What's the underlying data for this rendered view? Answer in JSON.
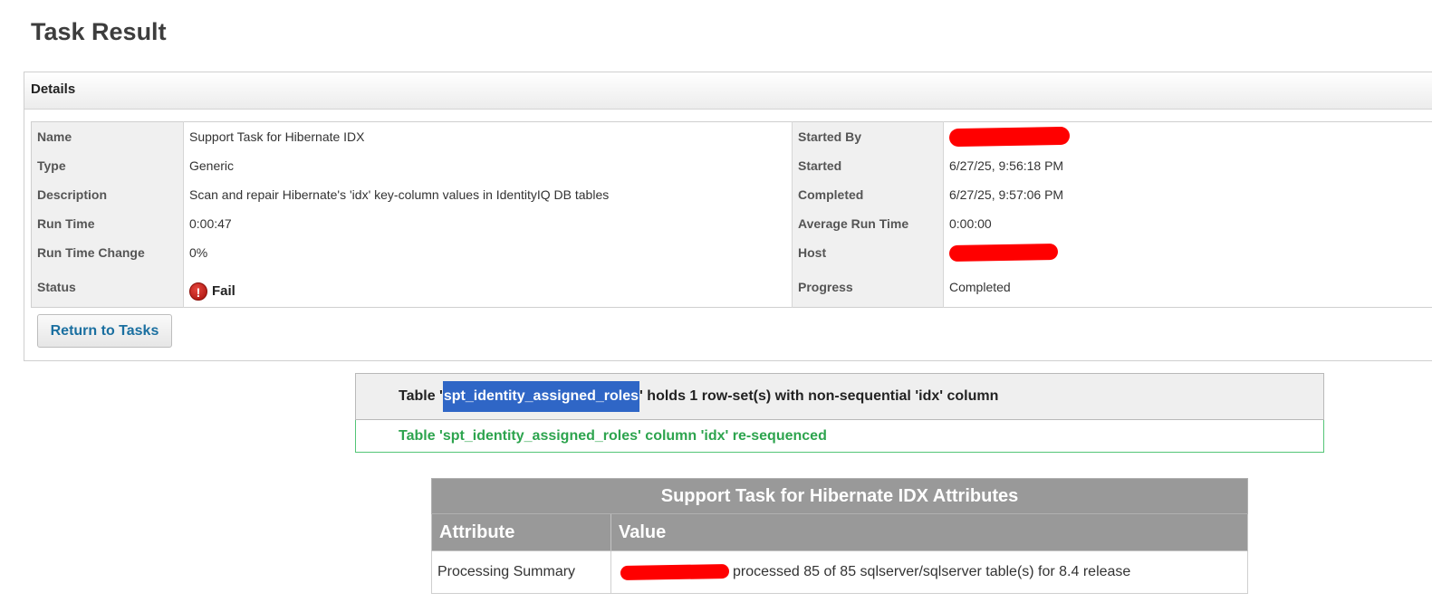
{
  "page": {
    "title": "Task Result"
  },
  "details": {
    "header": "Details",
    "left": [
      {
        "label": "Name",
        "value": "Support Task for Hibernate IDX"
      },
      {
        "label": "Type",
        "value": "Generic"
      },
      {
        "label": "Description",
        "value": "Scan and repair Hibernate's 'idx' key-column values in IdentityIQ DB tables"
      },
      {
        "label": "Run Time",
        "value": "0:00:47"
      },
      {
        "label": "Run Time Change",
        "value": "0%"
      },
      {
        "label": "Status",
        "value": "Fail",
        "icon": "error-icon"
      }
    ],
    "right": [
      {
        "label": "Started By",
        "value": ""
      },
      {
        "label": "Started",
        "value": "6/27/25, 9:56:18 PM"
      },
      {
        "label": "Completed",
        "value": "6/27/25, 9:57:06 PM"
      },
      {
        "label": "Average Run Time",
        "value": "0:00:00"
      },
      {
        "label": "Host",
        "value": ""
      },
      {
        "label": "Progress",
        "value": "Completed"
      }
    ],
    "return_button": "Return to Tasks"
  },
  "message": {
    "prefix": "Table '",
    "table_name": "spt_identity_assigned_roles",
    "suffix": "' holds 1 row-set(s) with non-sequential 'idx' column",
    "result": "Table 'spt_identity_assigned_roles' column 'idx' re-sequenced"
  },
  "attributes": {
    "caption": "Support Task for Hibernate IDX Attributes",
    "columns": [
      "Attribute",
      "Value"
    ],
    "rows": [
      {
        "attribute": "Processing Summary",
        "value": "processed 85 of 85 sqlserver/sqlserver table(s) for 8.4 release"
      }
    ]
  },
  "colors": {
    "accent_link": "#1a6fa0",
    "success": "#2da44e",
    "error": "#c0160f",
    "selection": "#2f66c6",
    "redaction": "#ff0000"
  }
}
